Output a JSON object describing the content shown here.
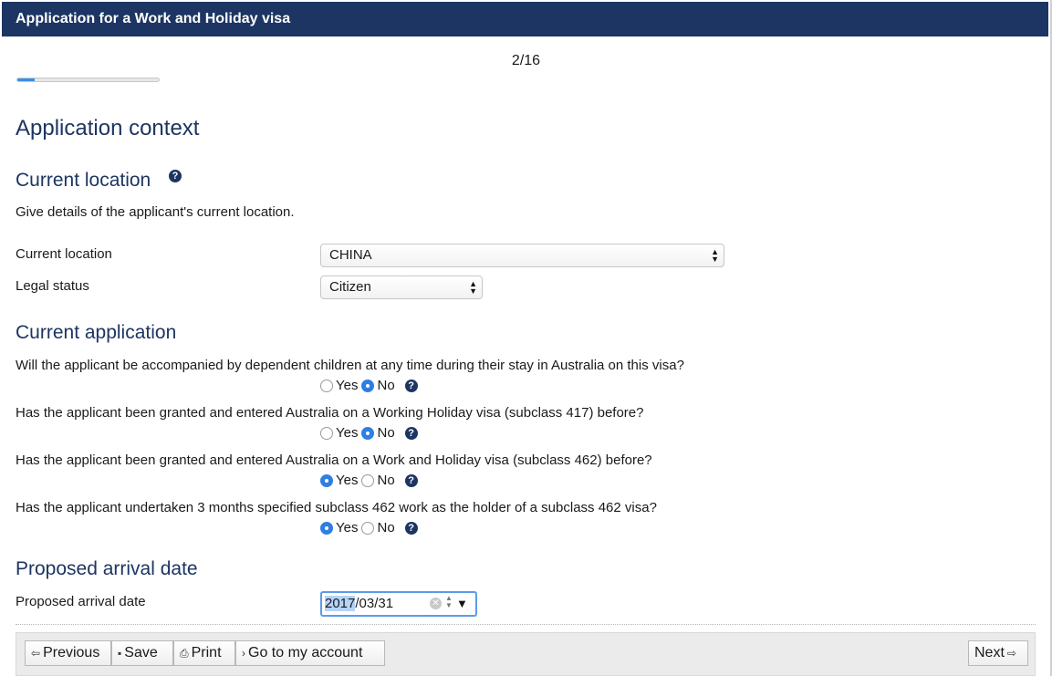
{
  "header": {
    "title": "Application for a Work and Holiday visa"
  },
  "progress": {
    "step_text": "2/16",
    "fraction": 0.125,
    "color": "#3a8ee6"
  },
  "page": {
    "title": "Application context"
  },
  "location_section": {
    "title": "Current location",
    "help_icon": "help-icon",
    "description": "Give details of the applicant's current location.",
    "fields": {
      "current_location": {
        "label": "Current location",
        "value": "CHINA"
      },
      "legal_status": {
        "label": "Legal status",
        "value": "Citizen"
      }
    }
  },
  "application_section": {
    "title": "Current application",
    "yes_label": "Yes",
    "no_label": "No",
    "questions": [
      {
        "text": "Will the applicant be accompanied by dependent children at any time during their stay in Australia on this visa?",
        "selected": "No"
      },
      {
        "text": "Has the applicant been granted and entered Australia on a Working Holiday visa (subclass 417) before?",
        "selected": "No"
      },
      {
        "text": "Has the applicant been granted and entered Australia on a Work and Holiday visa (subclass 462) before?",
        "selected": "Yes"
      },
      {
        "text": "Has the applicant undertaken 3 months specified subclass 462 work as the holder of a subclass 462 visa?",
        "selected": "Yes"
      }
    ]
  },
  "arrival_section": {
    "title": "Proposed arrival date",
    "label": "Proposed arrival date",
    "date_year": "2017",
    "date_rest": "/03/31"
  },
  "footer": {
    "previous_label": "Previous",
    "save_label": "Save",
    "print_label": "Print",
    "account_label": "Go to my account",
    "next_label": "Next"
  },
  "colors": {
    "header_bg": "#1d3562",
    "accent": "#2f7fe3"
  }
}
